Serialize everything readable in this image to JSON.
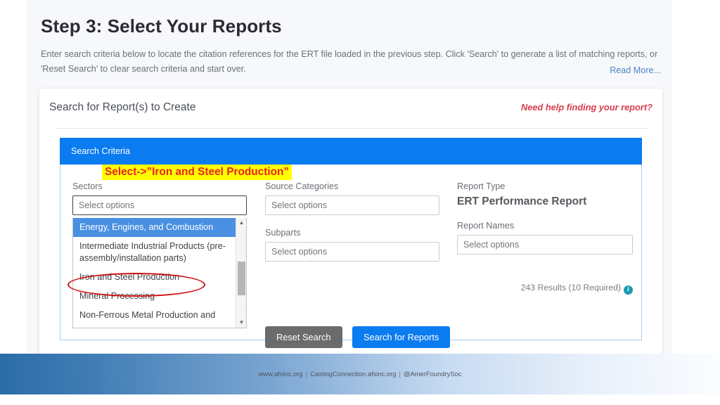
{
  "page": {
    "title": "Step 3: Select Your Reports",
    "description": "Enter search criteria below to locate the citation references for the ERT file loaded in the previous step. Click 'Search' to generate a list of matching reports, or 'Reset Search' to clear search criteria and start over.",
    "read_more_label": "Read More..."
  },
  "card": {
    "title": "Search for Report(s) to Create",
    "help_link": "Need help finding your report?"
  },
  "criteria": {
    "header": "Search Criteria",
    "fields": {
      "sectors": {
        "label": "Sectors",
        "placeholder": "Select options",
        "value": ""
      },
      "source_categories": {
        "label": "Source Categories",
        "placeholder": "Select options",
        "value": ""
      },
      "subparts": {
        "label": "Subparts",
        "placeholder": "Select options",
        "value": ""
      },
      "report_type": {
        "label": "Report Type",
        "value": "ERT Performance Report"
      },
      "report_names": {
        "label": "Report Names",
        "placeholder": "Select options",
        "value": ""
      }
    },
    "dropdown": {
      "open": true,
      "options": [
        {
          "label": "Energy, Engines, and Combustion",
          "selected": true
        },
        {
          "label": "Intermediate Industrial Products (pre-assembly/installation parts)",
          "selected": false
        },
        {
          "label": "Iron and Steel Production",
          "selected": false
        },
        {
          "label": "Mineral Processing",
          "selected": false
        },
        {
          "label": "Non-Ferrous Metal Production and",
          "selected": false
        }
      ],
      "scroll_up_icon": "▲",
      "scroll_down_icon": "▼"
    },
    "results_text": "243 Results (10 Required)",
    "results_count": 243,
    "results_required": 10,
    "info_icon_glyph": "i",
    "buttons": {
      "reset": "Reset Search",
      "search": "Search for Reports"
    }
  },
  "annotations": {
    "highlight_text": "Select->”Iron and Steel Production”",
    "highlight_bg": "#ffff00",
    "highlight_color": "#e8231a",
    "ellipse_color": "#cc1111",
    "ellipse_target": "Iron and Steel Production"
  },
  "footer": {
    "website": "www.afsinc.org",
    "separator": "|",
    "portal": "CastingConnection.afsinc.org",
    "social": "@AmerFoundrySoc"
  },
  "colors": {
    "accent_blue": "#0b7bf0",
    "panel_border": "#a9cdeb",
    "selected_option": "#4a90e2",
    "help_red": "#d93b4b",
    "info_teal": "#1a9bb0",
    "reset_gray": "#6b6b6b"
  }
}
